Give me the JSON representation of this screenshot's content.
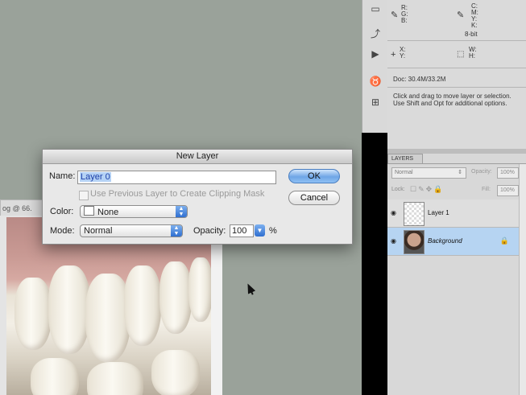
{
  "document": {
    "tab_label": "og @ 66.",
    "photo_alt": ""
  },
  "tools": [
    "histogram-icon",
    "history-icon",
    "actions-icon",
    "styles-icon",
    "layer-comps-icon"
  ],
  "info_panel": {
    "rgb_labels": [
      "R:",
      "G:",
      "B:"
    ],
    "cmyk_labels": [
      "C:",
      "M:",
      "Y:",
      "K:"
    ],
    "bit_depth": "8-bit",
    "xy_labels": [
      "X:",
      "Y:"
    ],
    "wh_labels": [
      "W:",
      "H:"
    ],
    "doc_size": "Doc: 30.4M/33.2M",
    "hint_line1": "Click and drag to move layer or selection.",
    "hint_line2": "Use Shift and Opt for additional options."
  },
  "layers_panel": {
    "tab_label": "LAYERS",
    "blend_mode": "Normal",
    "opacity_label": "Opacity:",
    "opacity_value": "100%",
    "lock_label": "Lock:",
    "fill_label": "Fill:",
    "fill_value": "100%",
    "layers": [
      {
        "name": "Layer 1",
        "selected": false,
        "locked": false
      },
      {
        "name": "Background",
        "selected": true,
        "locked": true
      }
    ]
  },
  "dialog": {
    "title": "New Layer",
    "name_label": "Name:",
    "name_value": "Layer 0",
    "clipping_checkbox_label": "Use Previous Layer to Create Clipping Mask",
    "clipping_checked": false,
    "color_label": "Color:",
    "color_value": "None",
    "mode_label": "Mode:",
    "mode_value": "Normal",
    "opacity_label": "Opacity:",
    "opacity_value": "100",
    "opacity_unit": "%",
    "ok_label": "OK",
    "cancel_label": "Cancel"
  }
}
